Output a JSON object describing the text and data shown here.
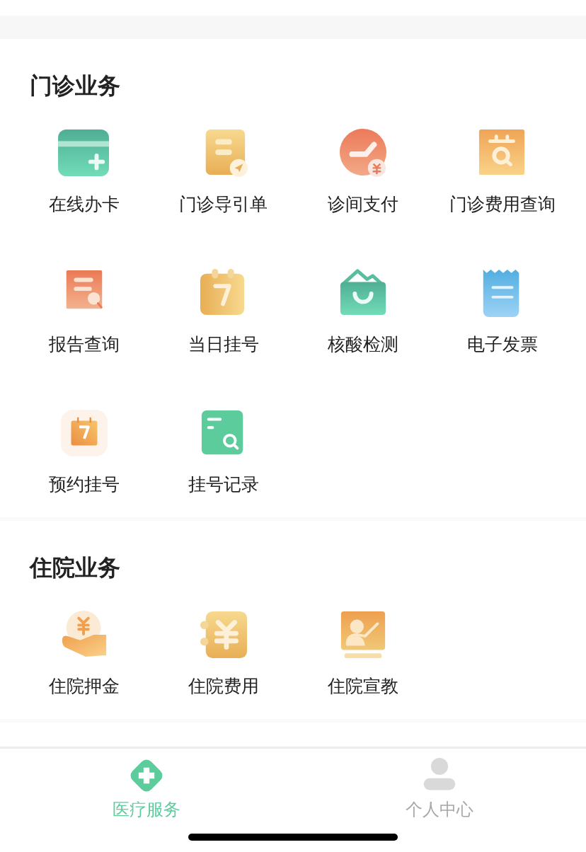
{
  "sections": [
    {
      "title": "门诊业务",
      "items": [
        {
          "label": "在线办卡",
          "kind": "card"
        },
        {
          "label": "门诊导引单",
          "kind": "guide"
        },
        {
          "label": "诊间支付",
          "kind": "pay"
        },
        {
          "label": "门诊费用查询",
          "kind": "fee_query"
        },
        {
          "label": "报告查询",
          "kind": "report"
        },
        {
          "label": "当日挂号",
          "kind": "today"
        },
        {
          "label": "核酸检测",
          "kind": "bag"
        },
        {
          "label": "电子发票",
          "kind": "invoice"
        },
        {
          "label": "预约挂号",
          "kind": "appointment"
        },
        {
          "label": "挂号记录",
          "kind": "record"
        }
      ]
    },
    {
      "title": "住院业务",
      "items": [
        {
          "label": "住院押金",
          "kind": "deposit"
        },
        {
          "label": "住院费用",
          "kind": "fee"
        },
        {
          "label": "住院宣教",
          "kind": "education"
        }
      ]
    }
  ],
  "tab_bar": [
    {
      "label": "医疗服务",
      "kind": "medical",
      "selected": true
    },
    {
      "label": "个人中心",
      "kind": "person",
      "selected": false
    }
  ]
}
